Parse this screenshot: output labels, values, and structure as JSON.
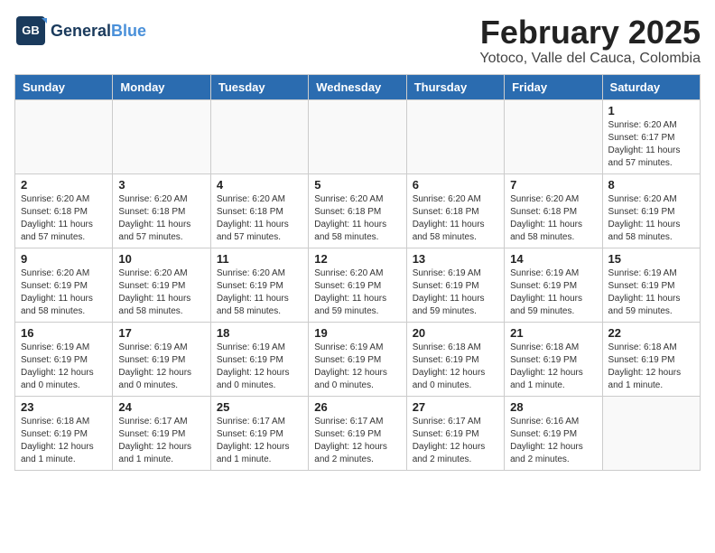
{
  "header": {
    "logo_general": "General",
    "logo_blue": "Blue",
    "title": "February 2025",
    "subtitle": "Yotoco, Valle del Cauca, Colombia"
  },
  "days_of_week": [
    "Sunday",
    "Monday",
    "Tuesday",
    "Wednesday",
    "Thursday",
    "Friday",
    "Saturday"
  ],
  "weeks": [
    [
      {
        "day": "",
        "info": ""
      },
      {
        "day": "",
        "info": ""
      },
      {
        "day": "",
        "info": ""
      },
      {
        "day": "",
        "info": ""
      },
      {
        "day": "",
        "info": ""
      },
      {
        "day": "",
        "info": ""
      },
      {
        "day": "1",
        "info": "Sunrise: 6:20 AM\nSunset: 6:17 PM\nDaylight: 11 hours\nand 57 minutes."
      }
    ],
    [
      {
        "day": "2",
        "info": "Sunrise: 6:20 AM\nSunset: 6:18 PM\nDaylight: 11 hours\nand 57 minutes."
      },
      {
        "day": "3",
        "info": "Sunrise: 6:20 AM\nSunset: 6:18 PM\nDaylight: 11 hours\nand 57 minutes."
      },
      {
        "day": "4",
        "info": "Sunrise: 6:20 AM\nSunset: 6:18 PM\nDaylight: 11 hours\nand 57 minutes."
      },
      {
        "day": "5",
        "info": "Sunrise: 6:20 AM\nSunset: 6:18 PM\nDaylight: 11 hours\nand 58 minutes."
      },
      {
        "day": "6",
        "info": "Sunrise: 6:20 AM\nSunset: 6:18 PM\nDaylight: 11 hours\nand 58 minutes."
      },
      {
        "day": "7",
        "info": "Sunrise: 6:20 AM\nSunset: 6:18 PM\nDaylight: 11 hours\nand 58 minutes."
      },
      {
        "day": "8",
        "info": "Sunrise: 6:20 AM\nSunset: 6:19 PM\nDaylight: 11 hours\nand 58 minutes."
      }
    ],
    [
      {
        "day": "9",
        "info": "Sunrise: 6:20 AM\nSunset: 6:19 PM\nDaylight: 11 hours\nand 58 minutes."
      },
      {
        "day": "10",
        "info": "Sunrise: 6:20 AM\nSunset: 6:19 PM\nDaylight: 11 hours\nand 58 minutes."
      },
      {
        "day": "11",
        "info": "Sunrise: 6:20 AM\nSunset: 6:19 PM\nDaylight: 11 hours\nand 58 minutes."
      },
      {
        "day": "12",
        "info": "Sunrise: 6:20 AM\nSunset: 6:19 PM\nDaylight: 11 hours\nand 59 minutes."
      },
      {
        "day": "13",
        "info": "Sunrise: 6:19 AM\nSunset: 6:19 PM\nDaylight: 11 hours\nand 59 minutes."
      },
      {
        "day": "14",
        "info": "Sunrise: 6:19 AM\nSunset: 6:19 PM\nDaylight: 11 hours\nand 59 minutes."
      },
      {
        "day": "15",
        "info": "Sunrise: 6:19 AM\nSunset: 6:19 PM\nDaylight: 11 hours\nand 59 minutes."
      }
    ],
    [
      {
        "day": "16",
        "info": "Sunrise: 6:19 AM\nSunset: 6:19 PM\nDaylight: 12 hours\nand 0 minutes."
      },
      {
        "day": "17",
        "info": "Sunrise: 6:19 AM\nSunset: 6:19 PM\nDaylight: 12 hours\nand 0 minutes."
      },
      {
        "day": "18",
        "info": "Sunrise: 6:19 AM\nSunset: 6:19 PM\nDaylight: 12 hours\nand 0 minutes."
      },
      {
        "day": "19",
        "info": "Sunrise: 6:19 AM\nSunset: 6:19 PM\nDaylight: 12 hours\nand 0 minutes."
      },
      {
        "day": "20",
        "info": "Sunrise: 6:18 AM\nSunset: 6:19 PM\nDaylight: 12 hours\nand 0 minutes."
      },
      {
        "day": "21",
        "info": "Sunrise: 6:18 AM\nSunset: 6:19 PM\nDaylight: 12 hours\nand 1 minute."
      },
      {
        "day": "22",
        "info": "Sunrise: 6:18 AM\nSunset: 6:19 PM\nDaylight: 12 hours\nand 1 minute."
      }
    ],
    [
      {
        "day": "23",
        "info": "Sunrise: 6:18 AM\nSunset: 6:19 PM\nDaylight: 12 hours\nand 1 minute."
      },
      {
        "day": "24",
        "info": "Sunrise: 6:17 AM\nSunset: 6:19 PM\nDaylight: 12 hours\nand 1 minute."
      },
      {
        "day": "25",
        "info": "Sunrise: 6:17 AM\nSunset: 6:19 PM\nDaylight: 12 hours\nand 1 minute."
      },
      {
        "day": "26",
        "info": "Sunrise: 6:17 AM\nSunset: 6:19 PM\nDaylight: 12 hours\nand 2 minutes."
      },
      {
        "day": "27",
        "info": "Sunrise: 6:17 AM\nSunset: 6:19 PM\nDaylight: 12 hours\nand 2 minutes."
      },
      {
        "day": "28",
        "info": "Sunrise: 6:16 AM\nSunset: 6:19 PM\nDaylight: 12 hours\nand 2 minutes."
      },
      {
        "day": "",
        "info": ""
      }
    ]
  ]
}
